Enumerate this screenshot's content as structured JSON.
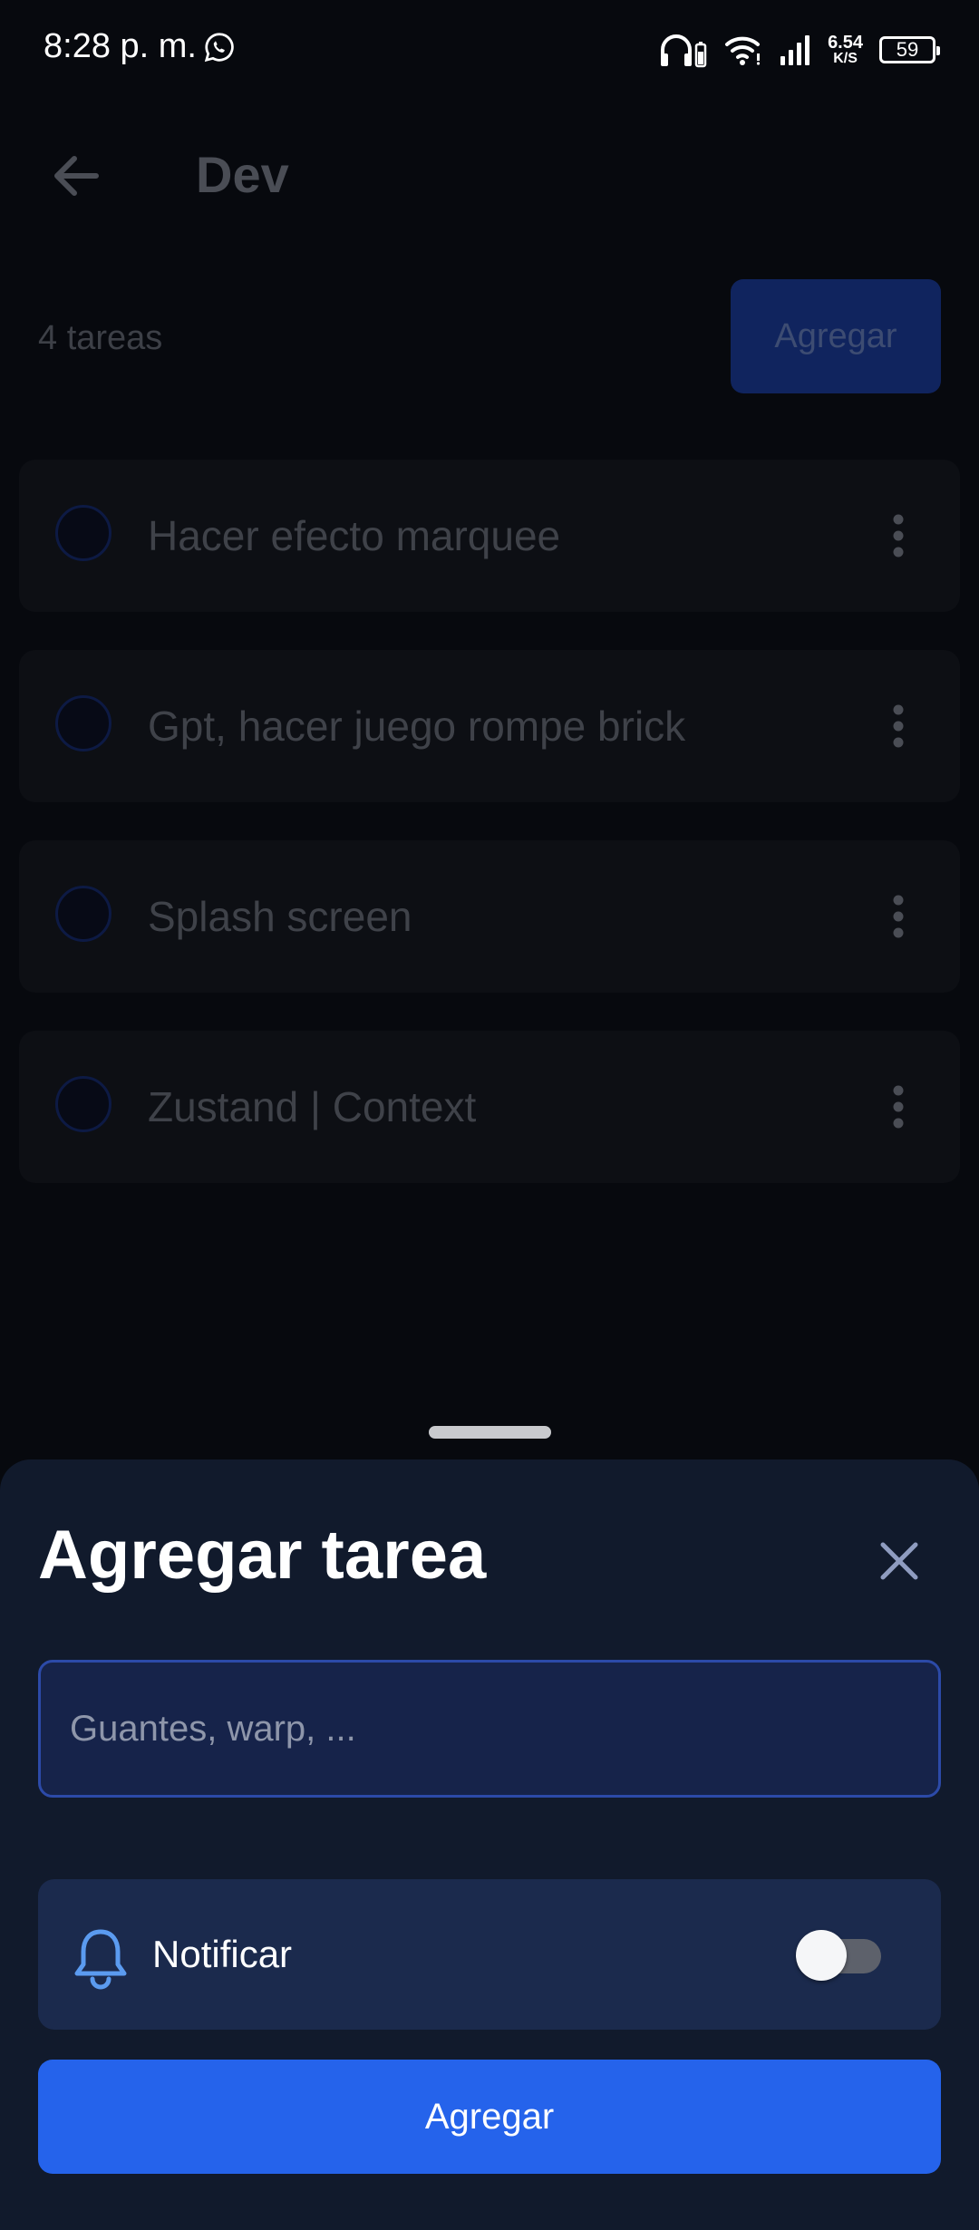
{
  "status_bar": {
    "time": "8:28 p. m.",
    "net_speed_value": "6.54",
    "net_speed_unit": "K/S",
    "battery": "59",
    "icons": [
      "whatsapp-icon",
      "headphones-icon",
      "wifi-icon",
      "signal-icon",
      "battery-icon"
    ]
  },
  "header": {
    "title": "Dev",
    "back_icon": "arrow-left-icon"
  },
  "summary": {
    "count_label": "4 tareas",
    "add_button": "Agregar"
  },
  "tasks": [
    {
      "label": "Hacer efecto marquee"
    },
    {
      "label": "Gpt, hacer juego rompe brick"
    },
    {
      "label": "Splash screen"
    },
    {
      "label": "Zustand | Context"
    }
  ],
  "sheet": {
    "title": "Agregar tarea",
    "close_icon": "close-icon",
    "input": {
      "value": "",
      "placeholder": "Guantes, warp, ..."
    },
    "notify": {
      "label": "Notificar",
      "icon": "bell-icon",
      "enabled": false
    },
    "submit_label": "Agregar"
  },
  "colors": {
    "background": "#07090e",
    "sheet": "#111a2c",
    "accent": "#2563eb",
    "input_border": "#2c4aa8"
  }
}
